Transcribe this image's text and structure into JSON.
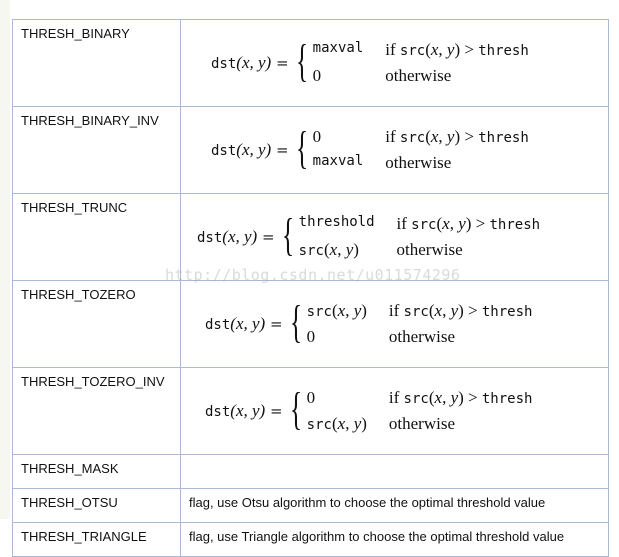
{
  "rows": [
    {
      "name": "THRESH_BINARY",
      "lhs": "dst",
      "c1v": "maxval",
      "c1v_mono": true,
      "c2v": "0",
      "c2v_mono": false,
      "cond1": "if",
      "src": "src",
      "thresh": "thresh",
      "cond2": "otherwise"
    },
    {
      "name": "THRESH_BINARY_INV",
      "c1v": "0",
      "c2v": "maxval"
    },
    {
      "name": "THRESH_TRUNC",
      "c1v": "threshold",
      "c2v": "src"
    },
    {
      "name": "THRESH_TOZERO",
      "c1v": "src",
      "c2v": "0"
    },
    {
      "name": "THRESH_TOZERO_INV",
      "c1v": "0",
      "c2v": "src"
    },
    {
      "name": "THRESH_MASK",
      "desc": ""
    },
    {
      "name": "THRESH_OTSU",
      "desc": "flag, use Otsu algorithm to choose the optimal threshold value"
    },
    {
      "name": "THRESH_TRIANGLE",
      "desc": "flag, use Triangle algorithm to choose the optimal threshold value"
    }
  ],
  "formula": {
    "lhs": "dst",
    "args": "(x, y)",
    "eq": "=",
    "if": "if",
    "src": "src",
    "gt": ">",
    "thresh": "thresh",
    "otherwise": "otherwise"
  },
  "watermark": "http://blog.csdn.net/u011574296",
  "border_color": "#a9b9d6"
}
